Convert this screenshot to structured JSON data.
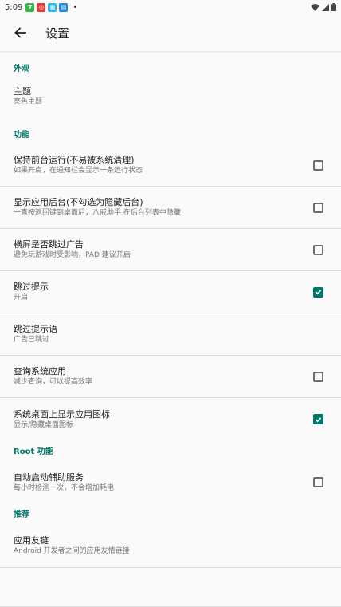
{
  "status_bar": {
    "time": "5:09",
    "app_icons": [
      "green-app-icon",
      "red-app-icon",
      "blue-app-icon",
      "blue-app-icon-2"
    ],
    "dot": "•"
  },
  "toolbar": {
    "title": "设置"
  },
  "sections": {
    "appearance": {
      "header": "外观",
      "theme": {
        "title": "主题",
        "summary": "亮色主题"
      }
    },
    "features": {
      "header": "功能",
      "items": [
        {
          "title": "保持前台运行(不易被系统清理)",
          "summary": "如果开启，在通知栏会显示一条运行状态",
          "checked": false
        },
        {
          "title": "显示应用后台(不勾选为隐藏后台)",
          "summary": "一直按返回键到桌面后，八戒助手 在后台列表中隐藏",
          "checked": false
        },
        {
          "title": "横屏是否跳过广告",
          "summary": "避免玩游戏时受影响，PAD 建议开启",
          "checked": false
        },
        {
          "title": "跳过提示",
          "summary": "开启",
          "checked": true
        },
        {
          "title": "跳过提示语",
          "summary": "广告已跳过"
        },
        {
          "title": "查询系统应用",
          "summary": "减少查询，可以提高效率",
          "checked": false
        },
        {
          "title": "系统桌面上显示应用图标",
          "summary": "显示/隐藏桌面图标",
          "checked": true
        }
      ]
    },
    "root": {
      "header": "Root 功能",
      "item": {
        "title": "自动启动辅助服务",
        "summary": "每小时检测一次，不会增加耗电",
        "checked": false
      }
    },
    "recommend": {
      "header": "推荐",
      "item": {
        "title": "应用友链",
        "summary": "Android 开发者之间的应用友情链接"
      }
    }
  },
  "colors": {
    "accent": "#00796b",
    "divider": "#dcdcdc"
  }
}
